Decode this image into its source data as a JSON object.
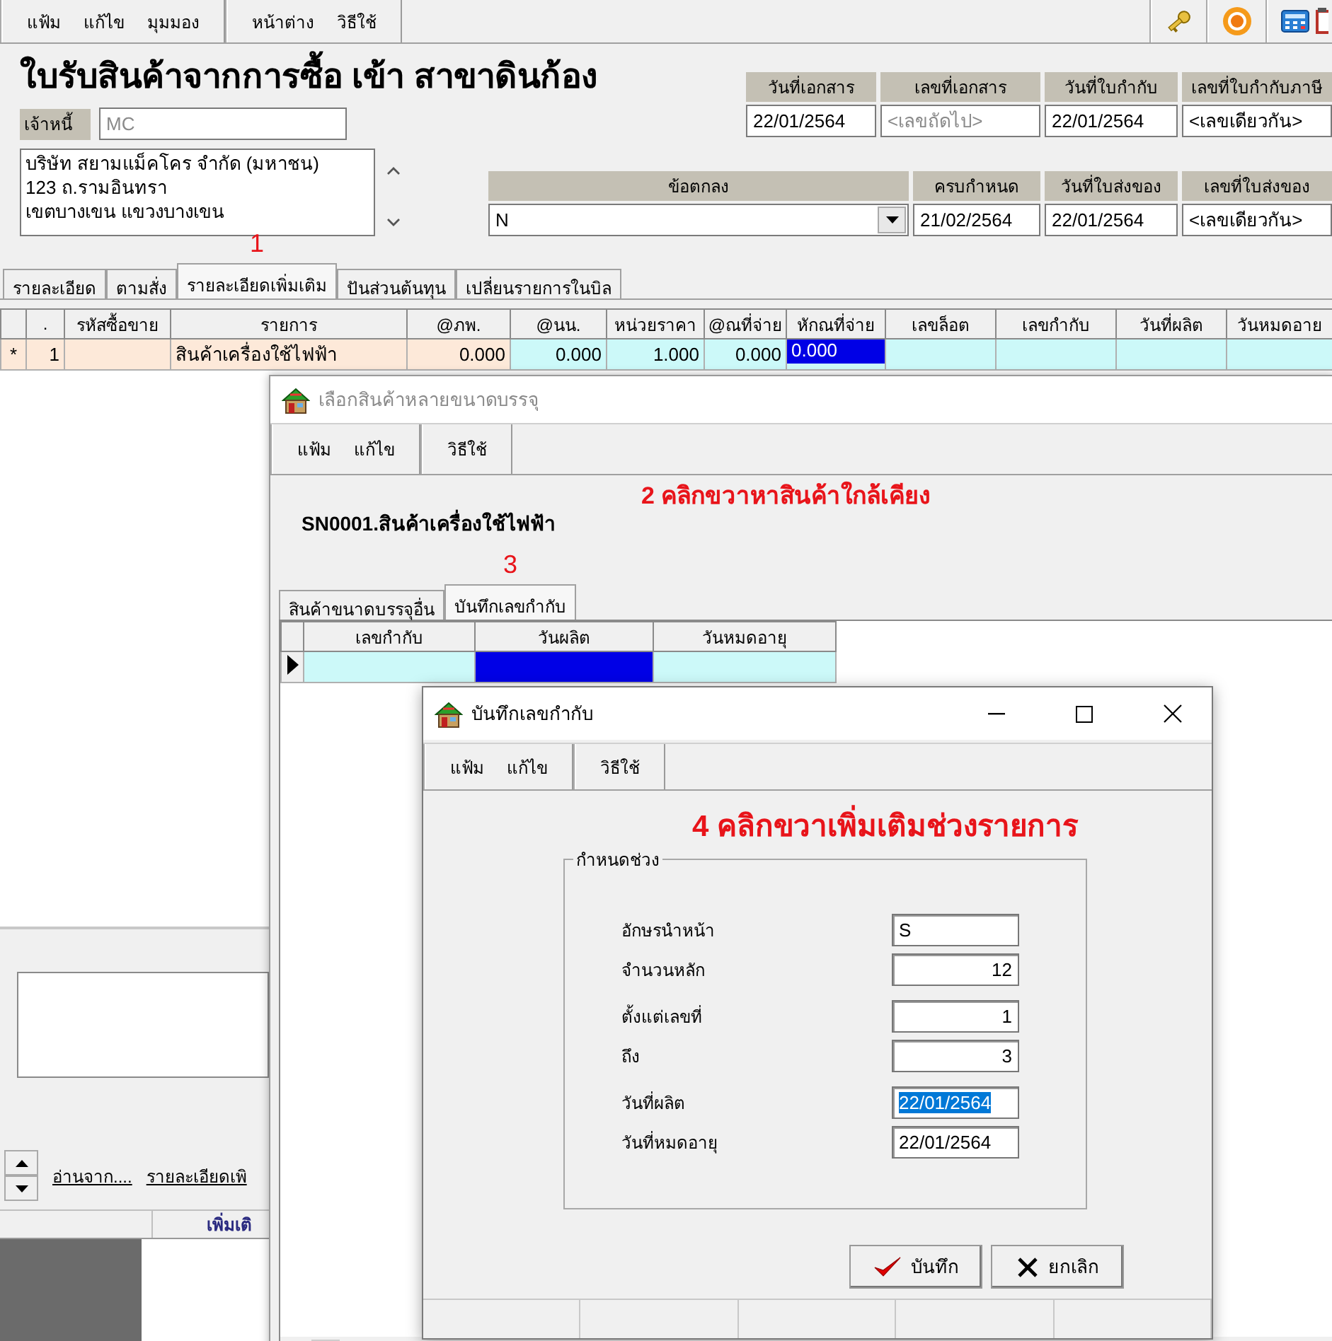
{
  "main_window": {
    "menus": [
      {
        "items": [
          "แฟ้ม",
          "แก้ไข",
          "มุมมอง"
        ]
      },
      {
        "items": [
          "หน้าต่าง",
          "วิธีใช้"
        ]
      }
    ],
    "title": "ใบรับสินค้าจากการซื้อ เข้า สาขาดินก้อง",
    "creditor": {
      "label": "เจ้าหนี้",
      "value": "MC",
      "disabled": true
    },
    "address_lines": [
      "บริษัท สยามแม็คโคร จำกัด (มหาชน)",
      "123 ถ.รามอินทรา",
      "เขตบางเขน แขวงบางเขน"
    ],
    "fields_row_1": [
      {
        "label": "วันที่เอกสาร",
        "value": "22/01/2564",
        "kind": "text"
      },
      {
        "label": "เลขที่เอกสาร",
        "placeholder": "<เลขถัดไป>",
        "kind": "text"
      },
      {
        "label": "วันที่ใบกำกับ",
        "value": "22/01/2564",
        "kind": "text"
      },
      {
        "label": "เลขที่ใบกำกับภาษี",
        "value": "<เลขเดียวกัน>",
        "kind": "text"
      }
    ],
    "fields_row_2": [
      {
        "label": "ข้อตกลง",
        "value": "N",
        "kind": "dropdown"
      },
      {
        "label": "ครบกำหนด",
        "value": "21/02/2564",
        "kind": "text"
      },
      {
        "label": "วันที่ใบส่งของ",
        "value": "22/01/2564",
        "kind": "text"
      },
      {
        "label": "เลขที่ใบส่งของ",
        "value": "<เลขเดียวกัน>",
        "kind": "text"
      }
    ],
    "tab_annotation": "1",
    "tabs": [
      {
        "label": "รายละเอียด",
        "selected": false
      },
      {
        "label": "ตามสั่ง",
        "selected": false
      },
      {
        "label": "รายละเอียดเพิ่มเติม",
        "selected": true
      },
      {
        "label": "ปันส่วนต้นทุน",
        "selected": false
      },
      {
        "label": "เปลี่ยนรายการในบิล",
        "selected": false
      }
    ],
    "table": {
      "columns": [
        {
          "label": ".",
          "kind": "number",
          "editable": false
        },
        {
          "label": "รหัสซื้อขาย",
          "kind": "text",
          "editable": false
        },
        {
          "label": "รายการ",
          "kind": "text",
          "editable": false
        },
        {
          "label": "@ภพ.",
          "kind": "number",
          "editable": false
        },
        {
          "label": "@นน.",
          "kind": "number",
          "editable": true
        },
        {
          "label": "หน่วยราคา",
          "kind": "number",
          "editable": true
        },
        {
          "label": "@ณที่จ่าย",
          "kind": "number",
          "editable": true
        },
        {
          "label": "หักณที่จ่าย",
          "kind": "text",
          "editable": true
        },
        {
          "label": "เลขล็อต",
          "kind": "text",
          "editable": true
        },
        {
          "label": "เลขกำกับ",
          "kind": "text",
          "editable": true
        },
        {
          "label": "วันที่ผลิต",
          "kind": "text",
          "editable": true
        },
        {
          "label": "วันหมดอาย",
          "kind": "text",
          "editable": true
        }
      ],
      "rows": [
        {
          "marker": "*",
          "cells": [
            {
              "text": "1",
              "selected": false
            },
            {
              "selected": false
            },
            {
              "text": "สินค้าเครื่องใช้ไฟฟ้า",
              "selected": false
            },
            {
              "text": "0.000",
              "selected": false
            },
            {
              "text": "0.000",
              "selected": false
            },
            {
              "text": "1.000",
              "selected": false
            },
            {
              "text": "0.000",
              "selected": false
            },
            {
              "text": "0.000",
              "selected": true
            },
            {
              "selected": false
            },
            {
              "selected": false
            },
            {
              "selected": false
            },
            {
              "selected": false
            }
          ]
        }
      ]
    },
    "links": [
      "อ่านจาก....",
      "รายละเอียดเพิ"
    ],
    "status_bar": [
      "เพิ่มเติ"
    ]
  },
  "product_window": {
    "title": "เลือกสินค้าหลายขนาดบรรจุ",
    "active": false,
    "menus": [
      {
        "items": [
          "แฟ้ม",
          "แก้ไข"
        ]
      },
      {
        "items": [
          "วิธีใช้"
        ]
      }
    ],
    "annotation": "2 คลิกขวาหาสินค้าใกล้เคียง",
    "product": "SN0001.สินค้าเครื่องใช้ไฟฟ้า",
    "tab_annotation": "3",
    "tabs": [
      {
        "label": "สินค้าขนาดบรรจุอื่น",
        "selected": false
      },
      {
        "label": "บันทึกเลขกำกับ",
        "selected": true
      }
    ],
    "grid": {
      "columns": [
        "เลขกำกับ",
        "วันผลิต",
        "วันหมดอายุ"
      ],
      "rows": [
        {
          "current": true,
          "cells": [
            {
              "selected": false
            },
            {
              "selected": true
            },
            {
              "selected": false
            }
          ]
        }
      ]
    }
  },
  "serial_dialog": {
    "title": "บันทึกเลขกำกับ",
    "active": true,
    "menus": [
      {
        "items": [
          "แฟ้ม",
          "แก้ไข"
        ]
      },
      {
        "items": [
          "วิธีใช้"
        ]
      }
    ],
    "annotation": "4 คลิกขวาเพิ่มเติมช่วงรายการ",
    "group": {
      "title": "กำหนดช่วง",
      "field_groups": [
        [
          {
            "label": "อักษรนำหน้า",
            "value": "S",
            "kind": "text",
            "selected": false
          },
          {
            "label": "จำนวนหลัก",
            "value": "12",
            "kind": "number",
            "selected": false
          }
        ],
        [
          {
            "label": "ตั้งแต่เลขที่",
            "value": "1",
            "kind": "number",
            "selected": false
          },
          {
            "label": "ถึง",
            "value": "3",
            "kind": "number",
            "selected": false
          }
        ],
        [
          {
            "label": "วันที่ผลิต",
            "value": "22/01/2564",
            "kind": "text",
            "selected": true
          },
          {
            "label": "วันที่หมดอายุ",
            "value": "22/01/2564",
            "kind": "text",
            "selected": false
          }
        ]
      ]
    },
    "buttons": [
      {
        "label": "บันทึก",
        "kind": "save"
      },
      {
        "label": "ยกเลิก",
        "kind": "cancel"
      }
    ]
  }
}
